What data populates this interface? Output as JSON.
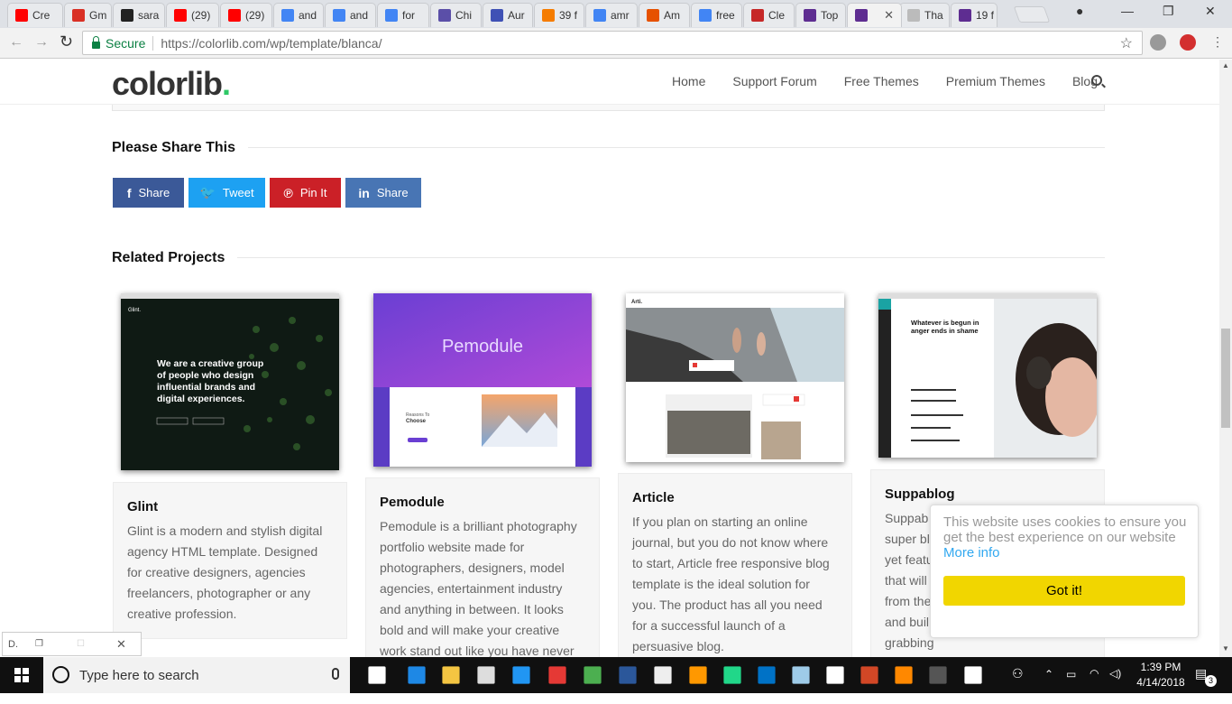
{
  "browser": {
    "tabs": [
      {
        "label": "Cre",
        "icon": "youtube-icon",
        "color": "#ff0000"
      },
      {
        "label": "Gm",
        "icon": "gmail-icon",
        "color": "#d93025"
      },
      {
        "label": "sara",
        "icon": "github-icon",
        "color": "#222222"
      },
      {
        "label": "(29)",
        "icon": "youtube-icon",
        "color": "#ff0000"
      },
      {
        "label": "(29)",
        "icon": "youtube-icon",
        "color": "#ff0000"
      },
      {
        "label": "and",
        "icon": "google-icon",
        "color": "#4285f4"
      },
      {
        "label": "and",
        "icon": "google-icon",
        "color": "#4285f4"
      },
      {
        "label": "for",
        "icon": "google-icon",
        "color": "#4285f4"
      },
      {
        "label": "Chi",
        "icon": "compass-icon",
        "color": "#5b4fa8"
      },
      {
        "label": "Aur",
        "icon": "s-letter-icon",
        "color": "#3f51b5"
      },
      {
        "label": "39 f",
        "icon": "her-icon",
        "color": "#f57c00"
      },
      {
        "label": "amr",
        "icon": "google-icon",
        "color": "#4285f4"
      },
      {
        "label": "Am",
        "icon": "fire-icon",
        "color": "#e65100"
      },
      {
        "label": "free",
        "icon": "google-icon",
        "color": "#4285f4"
      },
      {
        "label": "Cle",
        "icon": "s-letter-icon",
        "color": "#c62828"
      },
      {
        "label": "Top",
        "icon": "colorlib-icon",
        "color": "#5e2d91"
      },
      {
        "label": "",
        "icon": "colorlib-icon",
        "color": "#5e2d91",
        "active": true,
        "close": "✕"
      },
      {
        "label": "Tha",
        "icon": "loading-icon",
        "color": "#bbbbbb"
      },
      {
        "label": "19 f",
        "icon": "colorlib-icon",
        "color": "#5e2d91"
      }
    ],
    "window_controls": {
      "minimize": "—",
      "restore": "❐",
      "close": "✕"
    },
    "back": "←",
    "forward": "→",
    "reload": "↻",
    "secure_label": "Secure",
    "url": "https://colorlib.com/wp/template/blanca/",
    "bookmark": "☆"
  },
  "site": {
    "logo_text": "colorlib",
    "logo_dot": ".",
    "nav": [
      "Home",
      "Support Forum",
      "Free Themes",
      "Premium Themes",
      "Blog"
    ],
    "share_heading": "Please Share This",
    "share_buttons": [
      {
        "icon": "f",
        "label": "Share",
        "color": "#3b5998",
        "name": "facebook-share-button"
      },
      {
        "icon": "🐦",
        "label": "Tweet",
        "color": "#1da1f2",
        "name": "twitter-tweet-button"
      },
      {
        "icon": "℗",
        "label": "Pin It",
        "color": "#cb2027",
        "name": "pinterest-pin-button"
      },
      {
        "icon": "in",
        "label": "Share",
        "color": "#4875b4",
        "name": "linkedin-share-button"
      }
    ],
    "related_heading": "Related Projects",
    "projects": [
      {
        "title": "Glint",
        "desc": "Glint is a modern and stylish digital agency HTML template. Designed for creative designers, agencies freelancers, photographer or any creative profession.",
        "shot_text": "We are a creative group of people who design influential brands and digital experiences."
      },
      {
        "title": "Pemodule",
        "desc": "Pemodule is a brilliant photography portfolio website made for photographers, designers, model agencies, entertainment industry and anything in between.  It looks bold and will make your creative work stand out like you have never",
        "shot_text": "Pemodule"
      },
      {
        "title": "Article",
        "desc": "If you plan on starting an online journal, but you do not know where to start, Article free responsive blog template is the ideal solution for you. The product has all you need for a successful launch of a persuasive blog.",
        "shot_text": "Article"
      },
      {
        "title": "Suppablog",
        "desc": "Suppab super bl yet featu that will from the and buil grabbing blog.",
        "shot_text": "Whatever is begun in anger ends in shame"
      }
    ]
  },
  "cookie": {
    "message": "This website uses cookies to ensure you get the best experience on our website",
    "more": "More info",
    "button": "Got it!"
  },
  "download_bar": {
    "label": "D."
  },
  "taskbar": {
    "search_placeholder": "Type here to search",
    "time": "1:39 PM",
    "date": "4/14/2018",
    "notifications": "3"
  }
}
